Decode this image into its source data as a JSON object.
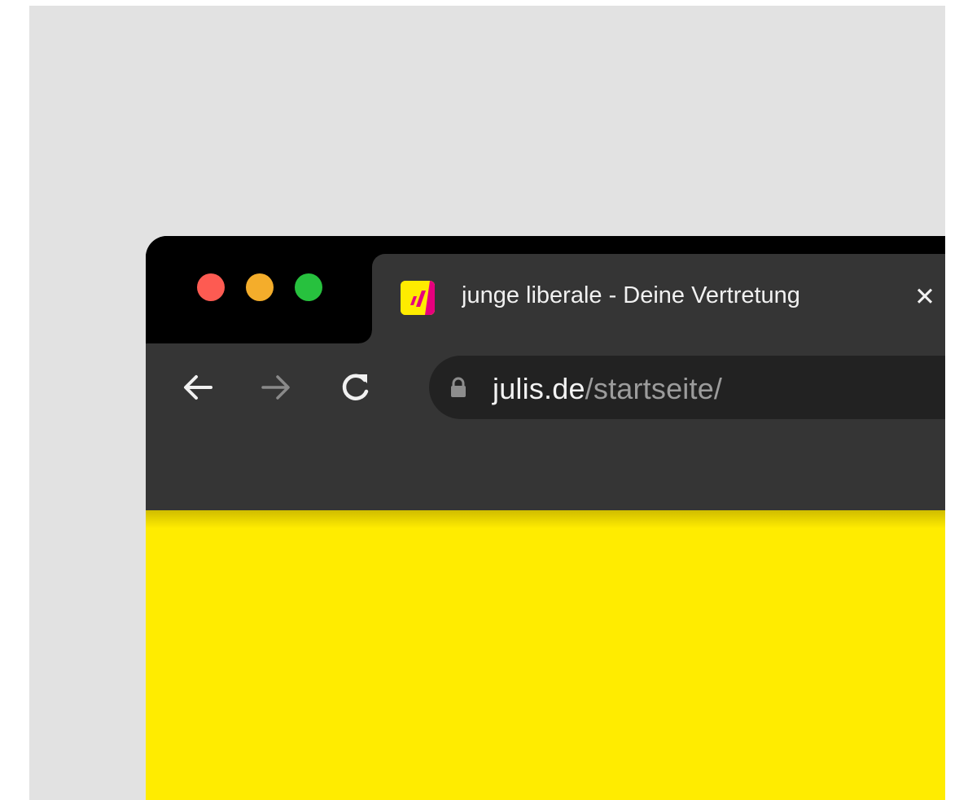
{
  "window": {
    "traffic_lights": {
      "close_color": "#fd5b52",
      "minimize_color": "#f4ad2b",
      "zoom_color": "#27c13e"
    }
  },
  "tab": {
    "title": "junge liberale - Deine Vertretung",
    "close_glyph": "✕",
    "favicon_icon": "julis-logo-icon"
  },
  "toolbar": {
    "back_icon": "arrow-left-icon",
    "forward_icon": "arrow-right-icon",
    "reload_icon": "reload-icon"
  },
  "address_bar": {
    "host": "julis.de",
    "path": "/startseite/",
    "lock_icon": "lock-icon"
  },
  "page": {
    "background_color": "#ffec00"
  }
}
